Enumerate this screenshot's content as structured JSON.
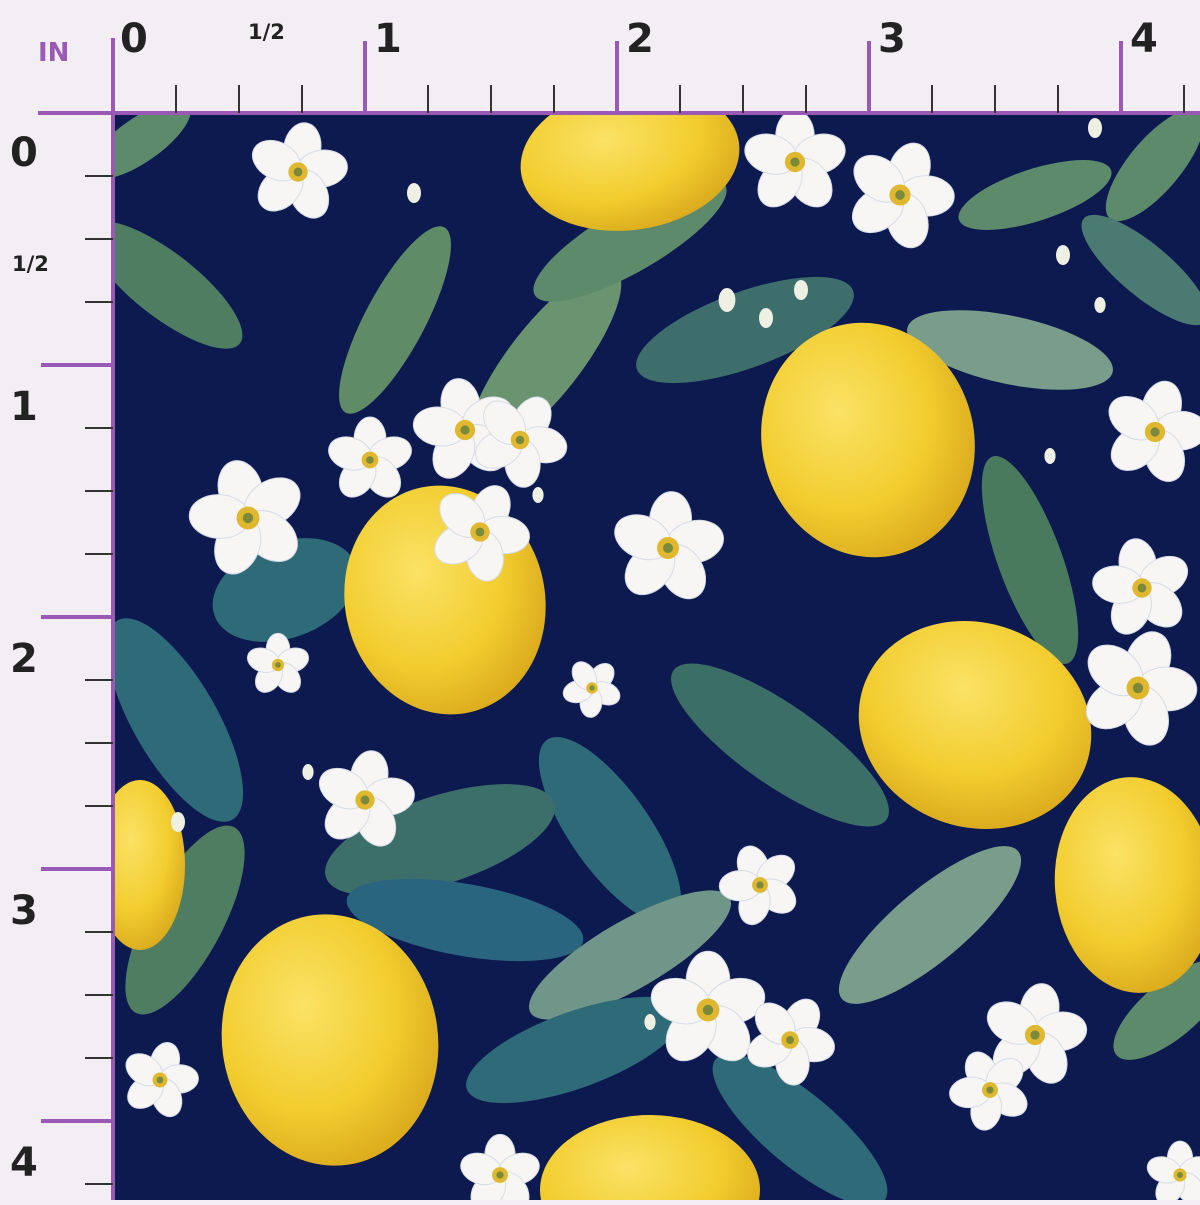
{
  "ruler": {
    "unit": "IN",
    "top_labels": [
      "0",
      "1/2",
      "1",
      "2",
      "3",
      "4"
    ],
    "left_labels": [
      "0",
      "1/2",
      "1",
      "2",
      "3",
      "4"
    ],
    "accent_color": "#9b59b6"
  },
  "fabric": {
    "background_color": "#0d1a4f",
    "lemon_color": "#f2cd2f",
    "leaf_colors": [
      "#5c8a6a",
      "#2f6a78",
      "#7a9c8a"
    ],
    "blossom_color": "#f7f6f4"
  }
}
